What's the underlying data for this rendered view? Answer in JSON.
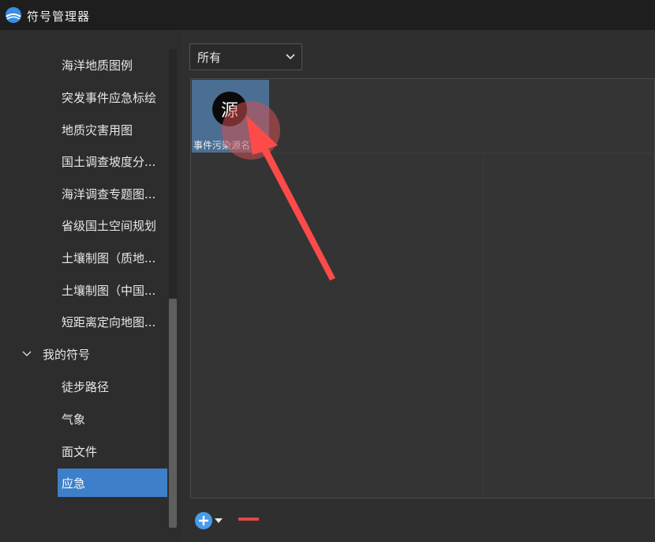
{
  "window": {
    "title": "符号管理器",
    "logo_icon": "app-logo-icon"
  },
  "sidebar": {
    "items": [
      {
        "label": "海洋地质图例"
      },
      {
        "label": "突发事件应急标绘"
      },
      {
        "label": "地质灾害用图"
      },
      {
        "label": "国土调查坡度分..."
      },
      {
        "label": "海洋调查专题图..."
      },
      {
        "label": "省级国土空间规划"
      },
      {
        "label": "土壤制图（质地..."
      },
      {
        "label": "土壤制图（中国..."
      },
      {
        "label": "短距离定向地图..."
      }
    ],
    "group": {
      "label": "我的符号",
      "expanded": true,
      "icon": "chevron-down-icon"
    },
    "group_items": [
      {
        "label": "徒步路径"
      },
      {
        "label": "气象"
      },
      {
        "label": "面文件"
      },
      {
        "label": "应急",
        "selected": true
      }
    ],
    "selected_color": "#3d7fc8"
  },
  "filter": {
    "selected": "所有",
    "icon": "chevron-down-icon"
  },
  "symbols": [
    {
      "glyph": "源",
      "label": "事件污染源名",
      "selected": true,
      "tile_color": "#4b6f93"
    }
  ],
  "annotation": {
    "arrow_color": "#ff4a4a",
    "icon": "red-arrow-pointer"
  },
  "toolbar": {
    "add_icon": "plus-circle-icon",
    "remove_icon": "minus-icon",
    "add_color": "#4a9be8",
    "remove_color": "#e04848"
  }
}
